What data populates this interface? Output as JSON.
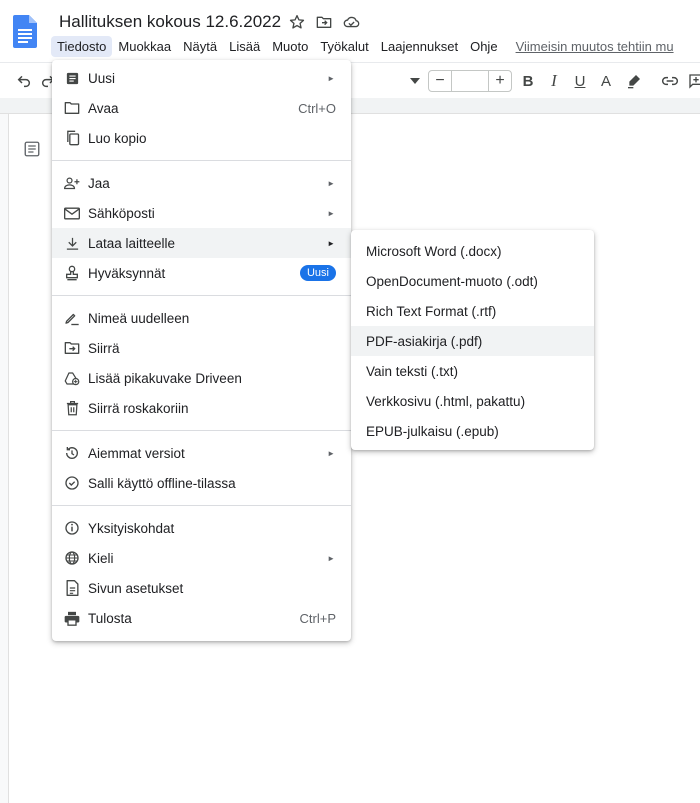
{
  "document": {
    "title": "Hallituksen kokous 12.6.2022",
    "last_edit": "Viimeisin muutos tehtiin mu"
  },
  "menubar": {
    "items": [
      "Tiedosto",
      "Muokkaa",
      "Näytä",
      "Lisää",
      "Muoto",
      "Työkalut",
      "Laajennukset",
      "Ohje"
    ],
    "active": "Tiedosto"
  },
  "colors": {
    "docs_blue": "#4285f4",
    "badge_blue": "#1a73e8",
    "menu_active_bg": "#e3e9f7",
    "hover_bg": "#f1f3f4"
  },
  "file_menu": {
    "groups": [
      [
        {
          "label": "Uusi",
          "icon": "new-doc-icon",
          "submenu": true
        },
        {
          "label": "Avaa",
          "icon": "folder-icon",
          "shortcut": "Ctrl+O"
        },
        {
          "label": "Luo kopio",
          "icon": "copy-icon"
        }
      ],
      [
        {
          "label": "Jaa",
          "icon": "share-person-icon",
          "submenu": true
        },
        {
          "label": "Sähköposti",
          "icon": "mail-icon",
          "submenu": true
        },
        {
          "label": "Lataa laitteelle",
          "icon": "download-icon",
          "submenu": true,
          "highlighted": true
        },
        {
          "label": "Hyväksynnät",
          "icon": "approval-stamp-icon",
          "badge": "Uusi"
        }
      ],
      [
        {
          "label": "Nimeä uudelleen",
          "icon": "rename-pen-icon"
        },
        {
          "label": "Siirrä",
          "icon": "move-folder-icon"
        },
        {
          "label": "Lisää pikakuvake Driveen",
          "icon": "drive-shortcut-icon"
        },
        {
          "label": "Siirrä roskakoriin",
          "icon": "trash-icon"
        }
      ],
      [
        {
          "label": "Aiemmat versiot",
          "icon": "history-icon",
          "submenu": true
        },
        {
          "label": "Salli käyttö offline-tilassa",
          "icon": "offline-check-icon"
        }
      ],
      [
        {
          "label": "Yksityiskohdat",
          "icon": "info-icon"
        },
        {
          "label": "Kieli",
          "icon": "globe-icon",
          "submenu": true
        },
        {
          "label": "Sivun asetukset",
          "icon": "page-setup-icon"
        },
        {
          "label": "Tulosta",
          "icon": "print-icon",
          "shortcut": "Ctrl+P"
        }
      ]
    ]
  },
  "download_submenu": {
    "items": [
      {
        "label": "Microsoft Word (.docx)"
      },
      {
        "label": "OpenDocument-muoto (.odt)"
      },
      {
        "label": "Rich Text Format (.rtf)"
      },
      {
        "label": "PDF-asiakirja (.pdf)",
        "highlighted": true
      },
      {
        "label": "Vain teksti (.txt)"
      },
      {
        "label": "Verkkosivu (.html, pakattu)"
      },
      {
        "label": "EPUB-julkaisu (.epub)"
      }
    ]
  }
}
